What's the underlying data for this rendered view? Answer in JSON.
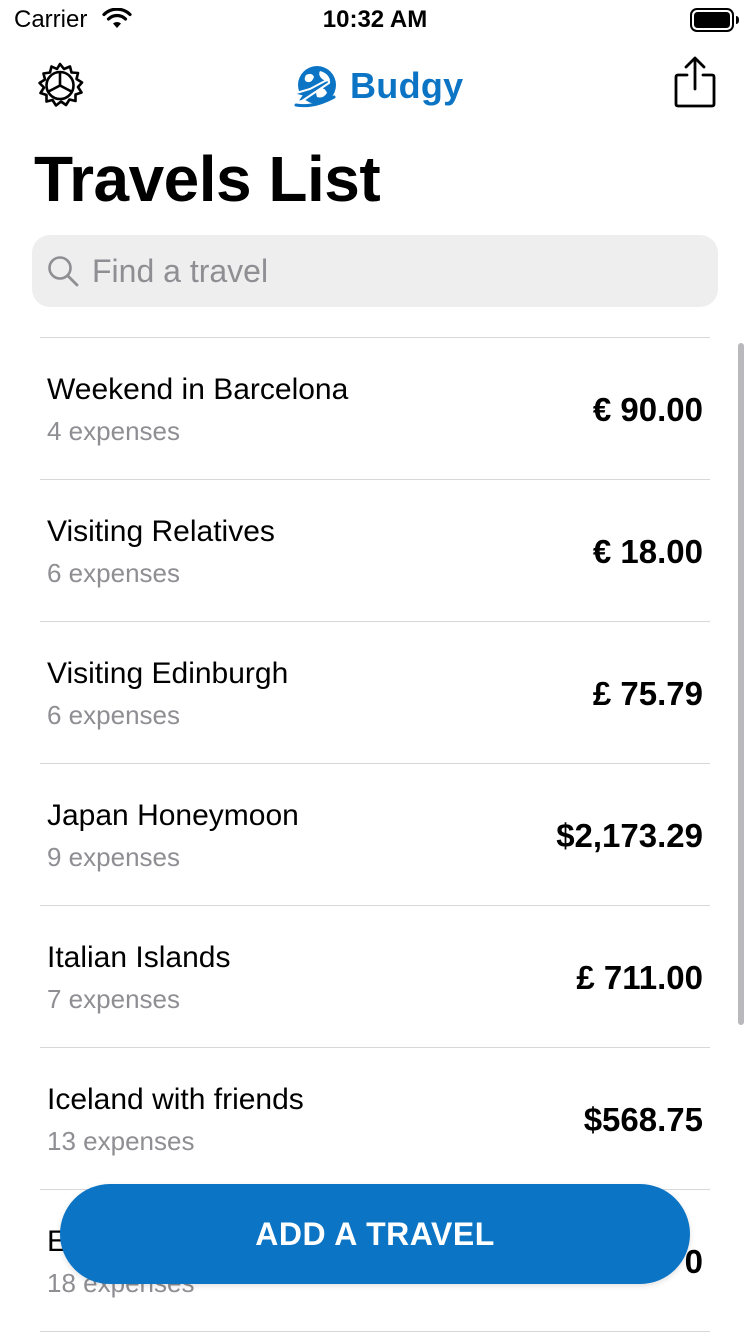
{
  "status_bar": {
    "carrier": "Carrier",
    "time": "10:32 AM"
  },
  "nav": {
    "settings_icon": "settings-gear-icon",
    "brand_name": "Budgy",
    "brand_logo": "globe-plane-logo",
    "share_icon": "share-icon"
  },
  "title": "Travels List",
  "search": {
    "placeholder": "Find a travel",
    "value": ""
  },
  "travels": [
    {
      "name": "Weekend in Barcelona",
      "expenses": "4 expenses",
      "amount": "€ 90.00"
    },
    {
      "name": "Visiting Relatives",
      "expenses": "6 expenses",
      "amount": "€ 18.00"
    },
    {
      "name": "Visiting Edinburgh",
      "expenses": "6 expenses",
      "amount": "£ 75.79"
    },
    {
      "name": "Japan Honeymoon",
      "expenses": "9 expenses",
      "amount": "$2,173.29"
    },
    {
      "name": "Italian Islands",
      "expenses": "7 expenses",
      "amount": "£ 711.00"
    },
    {
      "name": "Iceland with friends",
      "expenses": "13 expenses",
      "amount": "$568.75"
    },
    {
      "name": "E",
      "expenses": "18 expenses",
      "amount": "0"
    }
  ],
  "add_button_label": "ADD A TRAVEL",
  "colors": {
    "accent": "#0b74c4",
    "secondary_text": "#8e8e93",
    "search_background": "#eeeeef",
    "separator": "#d8d8dc"
  }
}
